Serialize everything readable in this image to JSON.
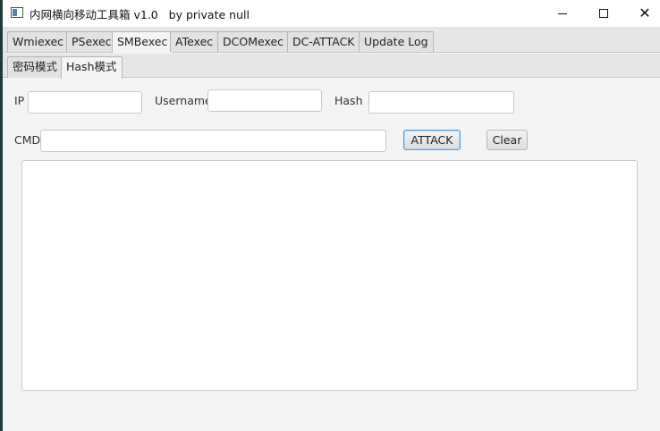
{
  "window": {
    "title": "内网横向移动工具箱 v1.0   by private null"
  },
  "tabs": [
    {
      "label": "Wmiexec",
      "active": false
    },
    {
      "label": "PSexec",
      "active": false
    },
    {
      "label": "SMBexec",
      "active": true
    },
    {
      "label": "ATexec",
      "active": false
    },
    {
      "label": "DCOMexec",
      "active": false
    },
    {
      "label": "DC-ATTACK",
      "active": false
    },
    {
      "label": "Update Log",
      "active": false
    }
  ],
  "subtabs": [
    {
      "label": "密码模式",
      "active": false
    },
    {
      "label": "Hash模式",
      "active": true
    }
  ],
  "form": {
    "ip_label": "IP",
    "ip_value": "",
    "username_label": "Username",
    "username_value": "",
    "hash_label": "Hash",
    "hash_value": "",
    "cmd_label": "CMD",
    "cmd_value": ""
  },
  "buttons": {
    "attack": "ATTACK",
    "clear": "Clear"
  },
  "output": {
    "text": ""
  },
  "colors": {
    "window_bg": "#f4f4f4",
    "focus_accent": "#4a9be0",
    "desktop_edge": "#1e3a3a"
  }
}
